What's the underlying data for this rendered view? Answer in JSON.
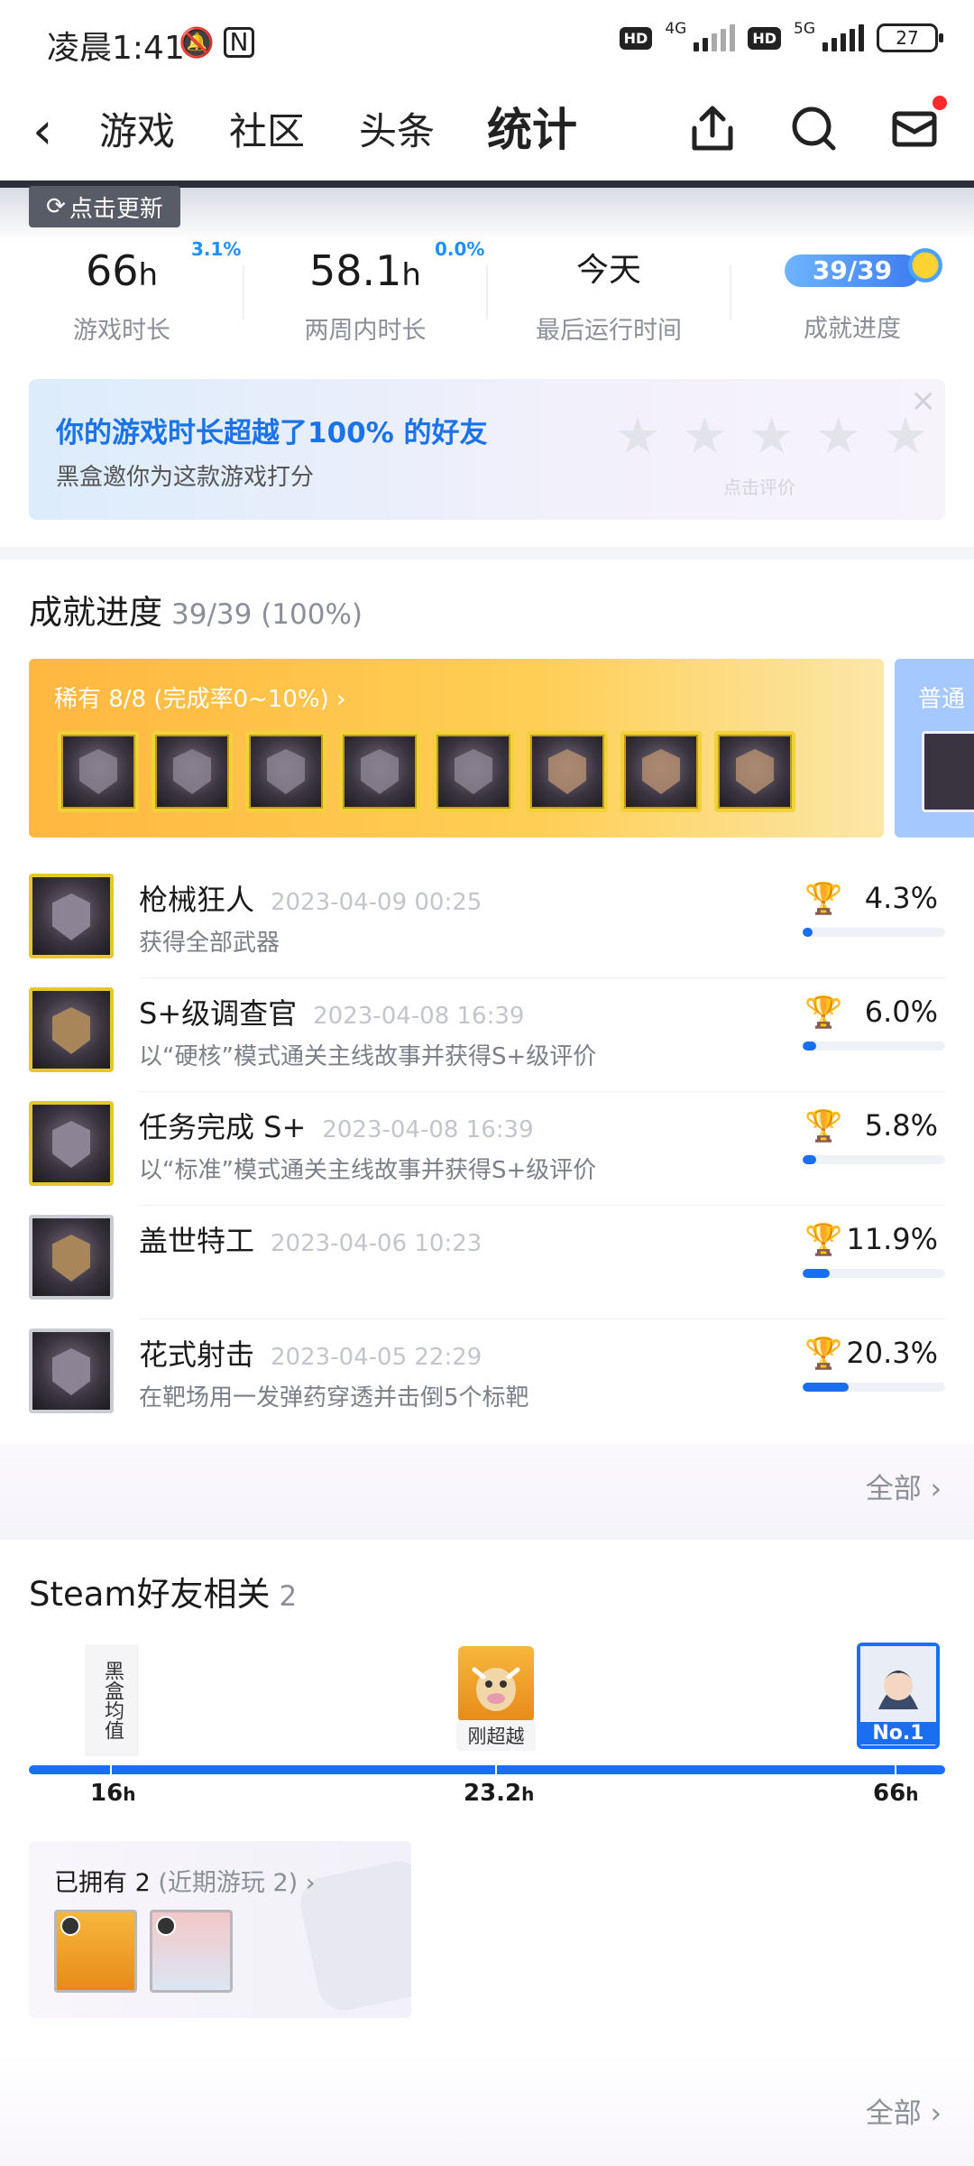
{
  "status_bar": {
    "time": "凌晨1:41",
    "net1": "4G",
    "net2": "5G",
    "hd": "HD",
    "battery": "27"
  },
  "nav": {
    "tabs": [
      "游戏",
      "社区",
      "头条",
      "统计"
    ],
    "active_tab": "统计"
  },
  "update_button": "点击更新",
  "stats": {
    "playtime": {
      "value": "66",
      "unit": "h",
      "label": "游戏时长",
      "change": "3.1%"
    },
    "two_weeks": {
      "value": "58.1",
      "unit": "h",
      "label": "两周内时长",
      "change": "0.0%"
    },
    "last_run": {
      "value": "今天",
      "label": "最后运行时间"
    },
    "achievement": {
      "value": "39/39",
      "label": "成就进度"
    }
  },
  "rate_card": {
    "title": "你的游戏时长超越了100% 的好友",
    "subtitle": "黑盒邀你为这款游戏打分",
    "hint": "点击评价",
    "stars": 5,
    "close": "×"
  },
  "achievements_section": {
    "title": "成就进度",
    "progress": "39/39 (100%)",
    "rare_label": "稀有 8/8 (完成率0~10%) ›",
    "rare_count": 8,
    "normal_label": "普通",
    "items": [
      {
        "name": "枪械狂人",
        "date": "2023-04-09 00:25",
        "desc": "获得全部武器",
        "rate": "4.3%",
        "trophy": "gold",
        "value": 4.3
      },
      {
        "name": "S+级调查官",
        "date": "2023-04-08 16:39",
        "desc": "以“硬核”模式通关主线故事并获得S+级评价",
        "rate": "6.0%",
        "trophy": "gold",
        "value": 6.0
      },
      {
        "name": "任务完成 S+",
        "date": "2023-04-08 16:39",
        "desc": "以“标准”模式通关主线故事并获得S+级评价",
        "rate": "5.8%",
        "trophy": "gold",
        "value": 5.8
      },
      {
        "name": "盖世特工",
        "date": "2023-04-06 10:23",
        "desc": "",
        "rate": "11.9%",
        "trophy": "silver",
        "value": 11.9
      },
      {
        "name": "花式射击",
        "date": "2023-04-05 22:29",
        "desc": "在靶场用一发弹药穿透并击倒5个标靶",
        "rate": "20.3%",
        "trophy": "silver",
        "value": 20.3
      }
    ],
    "all_link": "全部"
  },
  "friends_section": {
    "title": "Steam好友相关",
    "count": "2",
    "avg_label": "黑盒均值",
    "just_passed_label": "刚超越",
    "rank_label": "No.1",
    "ticks": [
      {
        "value": "16",
        "unit": "h"
      },
      {
        "value": "23.2",
        "unit": "h"
      },
      {
        "value": "66",
        "unit": "h"
      }
    ],
    "owned_label": "已拥有 2",
    "owned_recent": "(近期游玩 2) ›",
    "all_link": "全部"
  },
  "colors": {
    "accent": "#1a6ef0",
    "link_blue": "#1a73e8",
    "gold": "#f2b21b"
  }
}
